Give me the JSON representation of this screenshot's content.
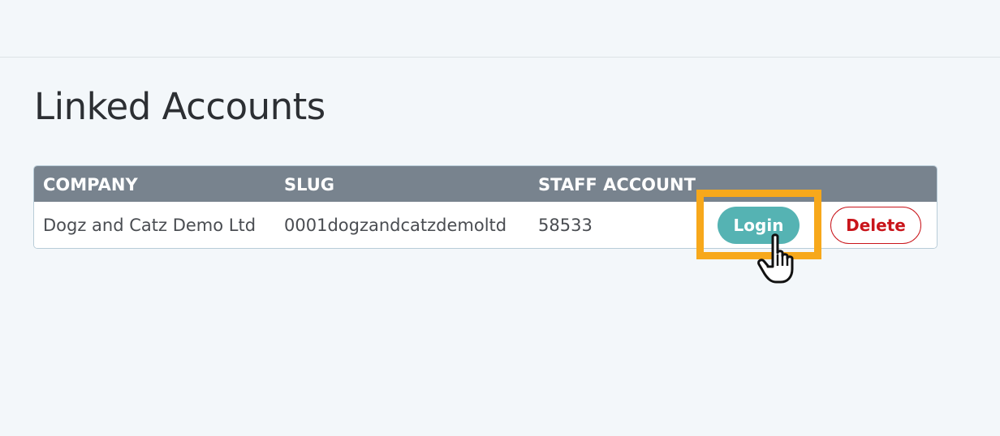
{
  "page": {
    "title": "Linked Accounts"
  },
  "table": {
    "headers": [
      "COMPANY",
      "SLUG",
      "STAFF ACCOUNT"
    ],
    "rows": [
      {
        "company": "Dogz and Catz Demo Ltd",
        "slug": "0001dogzandcatzdemoltd",
        "staff_account": "58533",
        "login_label": "Login",
        "delete_label": "Delete"
      }
    ]
  },
  "icons": {
    "cursor": "hand-pointer-icon"
  },
  "colors": {
    "header_bg": "#78838e",
    "login_bg": "#55b3b3",
    "delete_accent": "#c9151b",
    "highlight": "#f7a81b",
    "page_bg": "#f3f7fa"
  }
}
